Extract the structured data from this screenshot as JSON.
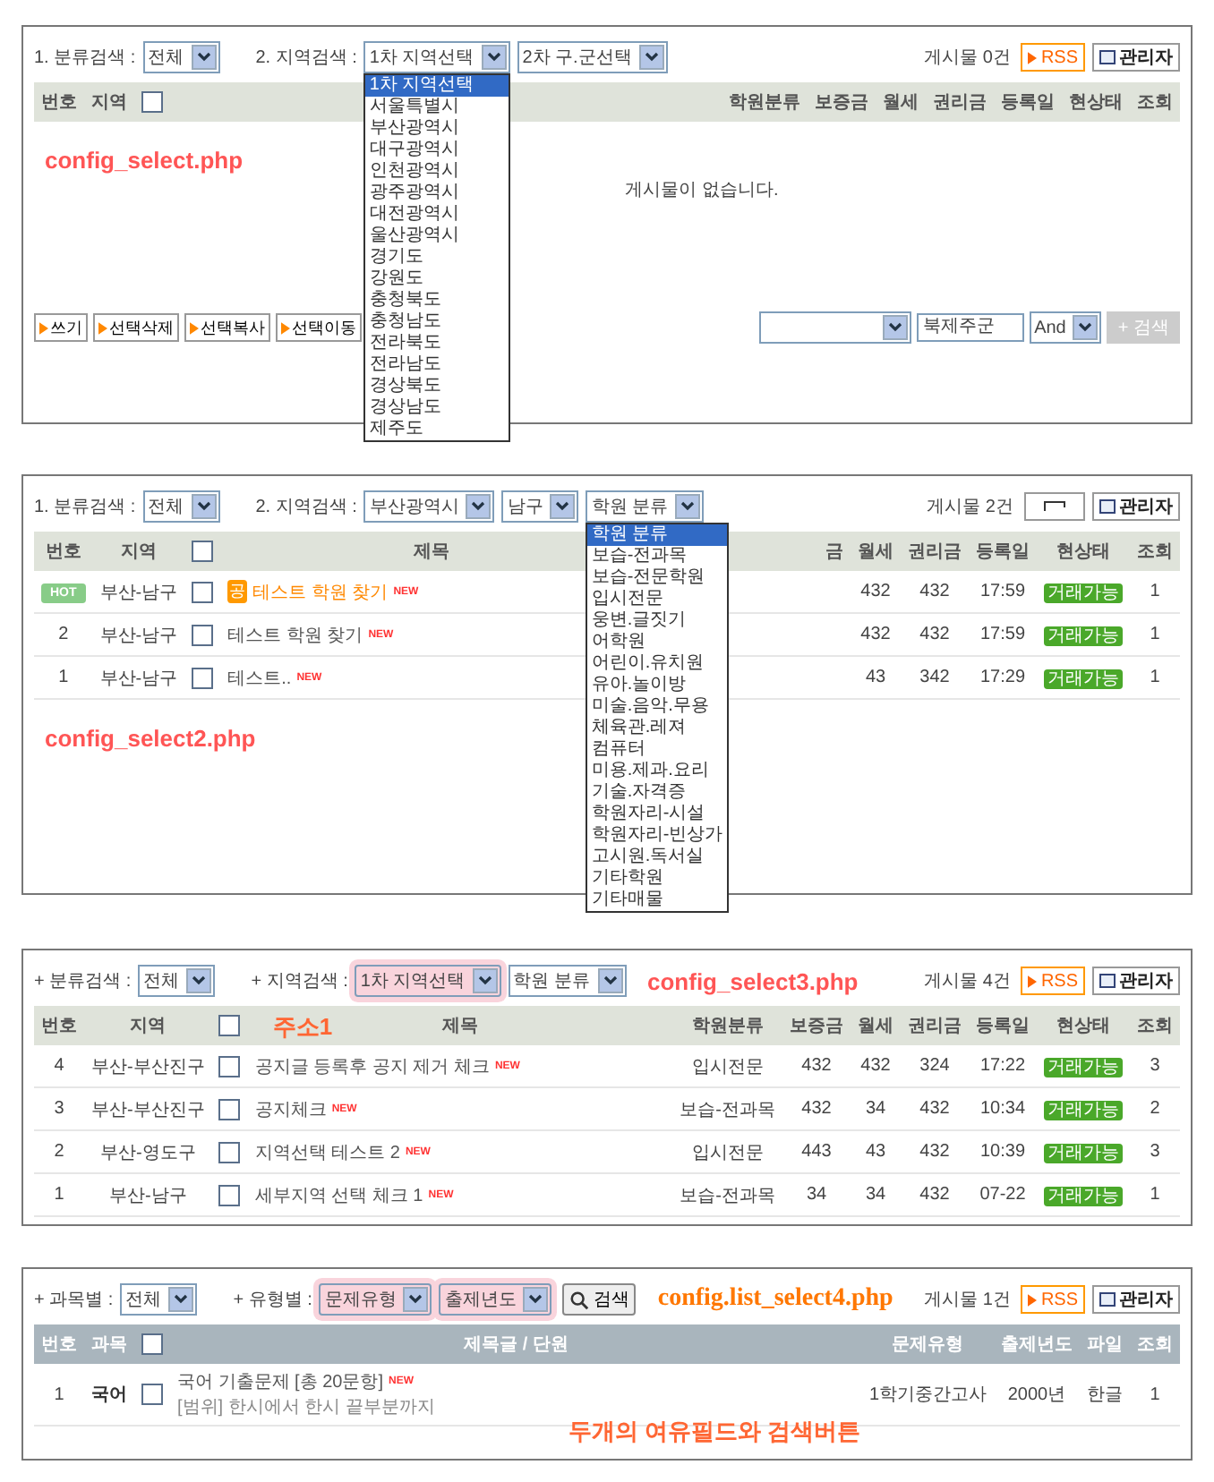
{
  "panels": [
    {
      "kind": "board",
      "filters": [
        {
          "label": "1. 분류검색 :",
          "selects": [
            {
              "value": "전체",
              "highlighted": false
            }
          ]
        },
        {
          "label": "2. 지역검색 :",
          "selects": [
            {
              "value": "1차 지역선택",
              "highlighted": false,
              "options": [
                {
                  "text": "1차 지역선택",
                  "selected": true
                },
                {
                  "text": "서울특별시",
                  "selected": false
                },
                {
                  "text": "부산광역시",
                  "selected": false
                },
                {
                  "text": "대구광역시",
                  "selected": false
                },
                {
                  "text": "인천광역시",
                  "selected": false
                },
                {
                  "text": "광주광역시",
                  "selected": false
                },
                {
                  "text": "대전광역시",
                  "selected": false
                },
                {
                  "text": "울산광역시",
                  "selected": false
                },
                {
                  "text": "경기도",
                  "selected": false
                },
                {
                  "text": "강원도",
                  "selected": false
                },
                {
                  "text": "충청북도",
                  "selected": false
                },
                {
                  "text": "충청남도",
                  "selected": false
                },
                {
                  "text": "전라북도",
                  "selected": false
                },
                {
                  "text": "전라남도",
                  "selected": false
                },
                {
                  "text": "경상북도",
                  "selected": false
                },
                {
                  "text": "경상남도",
                  "selected": false
                },
                {
                  "text": "제주도",
                  "selected": false
                }
              ]
            },
            {
              "value": "2차 구.군선택",
              "highlighted": false
            }
          ]
        }
      ],
      "count": "게시물 0건",
      "buttons": [
        {
          "kind": "rss",
          "label": "RSS"
        },
        {
          "kind": "admin",
          "label": "관리자"
        }
      ],
      "body_caption": {
        "kind": "filename",
        "text": "config_select.php"
      },
      "columns": [
        {
          "kind": "text",
          "label": "번호"
        },
        {
          "kind": "text",
          "label": "지역"
        },
        {
          "kind": "check",
          "checked": false
        },
        {
          "kind": "title"
        },
        {
          "kind": "text",
          "label": "학원분류"
        },
        {
          "kind": "text",
          "label": "보증금"
        },
        {
          "kind": "text",
          "label": "월세"
        },
        {
          "kind": "text",
          "label": "권리금"
        },
        {
          "kind": "text",
          "label": "등록일"
        },
        {
          "kind": "text",
          "label": "현상태"
        },
        {
          "kind": "text",
          "label": "조회"
        }
      ],
      "empty_text": "게시물이 없습니다.",
      "actions": [
        "쓰기",
        "선택삭제",
        "선택복사",
        "선택이동"
      ],
      "search": {
        "keyword": "북제주군",
        "operator": "And",
        "button": "+ 검색",
        "disabled": true
      }
    },
    {
      "kind": "board",
      "filters": [
        {
          "label": "1. 분류검색 :",
          "selects": [
            {
              "value": "전체",
              "highlighted": false
            }
          ]
        },
        {
          "label": "2. 지역검색 :",
          "selects": [
            {
              "value": "부산광역시",
              "highlighted": false
            },
            {
              "value": "남구",
              "highlighted": false
            },
            {
              "value": "학원 분류",
              "highlighted": false,
              "options": [
                {
                  "text": "학원 분류",
                  "selected": true
                },
                {
                  "text": "보습-전과목",
                  "selected": false
                },
                {
                  "text": "보습-전문학원",
                  "selected": false
                },
                {
                  "text": "입시전문",
                  "selected": false
                },
                {
                  "text": "웅변.글짓기",
                  "selected": false
                },
                {
                  "text": "어학원",
                  "selected": false
                },
                {
                  "text": "어린이.유치원",
                  "selected": false
                },
                {
                  "text": "유아.놀이방",
                  "selected": false
                },
                {
                  "text": "미술.음악.무용",
                  "selected": false
                },
                {
                  "text": "체육관.레져",
                  "selected": false
                },
                {
                  "text": "컴퓨터",
                  "selected": false
                },
                {
                  "text": "미용.제과.요리",
                  "selected": false
                },
                {
                  "text": "기술.자격증",
                  "selected": false
                },
                {
                  "text": "학원자리-시설",
                  "selected": false
                },
                {
                  "text": "학원자리-빈상가",
                  "selected": false
                },
                {
                  "text": "고시원.독서실",
                  "selected": false
                },
                {
                  "text": "기타학원",
                  "selected": false
                },
                {
                  "text": "기타매물",
                  "selected": false
                }
              ]
            }
          ]
        }
      ],
      "count": "게시물 2건",
      "buttons": [
        {
          "kind": "blank"
        },
        {
          "kind": "admin",
          "label": "관리자"
        }
      ],
      "body_caption": {
        "kind": "filename",
        "text": "config_select2.php"
      },
      "columns": [
        {
          "kind": "text",
          "label": "번호"
        },
        {
          "kind": "text",
          "label": "지역"
        },
        {
          "kind": "check",
          "checked": false
        },
        {
          "kind": "title",
          "label": "제목"
        },
        {
          "kind": "covered"
        },
        {
          "kind": "text",
          "label": "금"
        },
        {
          "kind": "text",
          "label": "월세"
        },
        {
          "kind": "text",
          "label": "권리금"
        },
        {
          "kind": "text",
          "label": "등록일"
        },
        {
          "kind": "text",
          "label": "현상태"
        },
        {
          "kind": "text",
          "label": "조회"
        }
      ],
      "rows": [
        {
          "cells": [
            {
              "kind": "hot",
              "text": "HOT"
            },
            {
              "kind": "text",
              "text": "부산-남구"
            },
            {
              "kind": "check",
              "checked": false
            },
            {
              "kind": "title",
              "notice": "공",
              "text": "테스트 학원 찾기",
              "new": "NEW"
            },
            {
              "kind": "covered"
            },
            {
              "kind": "covered"
            },
            {
              "kind": "text",
              "text": "432"
            },
            {
              "kind": "text",
              "text": "432"
            },
            {
              "kind": "text",
              "text": "17:59"
            },
            {
              "kind": "status",
              "text": "거래가능"
            },
            {
              "kind": "text",
              "text": "1"
            }
          ]
        },
        {
          "cells": [
            {
              "kind": "text",
              "text": "2"
            },
            {
              "kind": "text",
              "text": "부산-남구"
            },
            {
              "kind": "check",
              "checked": false
            },
            {
              "kind": "title",
              "text": "테스트 학원 찾기",
              "new": "NEW"
            },
            {
              "kind": "covered"
            },
            {
              "kind": "covered"
            },
            {
              "kind": "text",
              "text": "432"
            },
            {
              "kind": "text",
              "text": "432"
            },
            {
              "kind": "text",
              "text": "17:59"
            },
            {
              "kind": "status",
              "text": "거래가능"
            },
            {
              "kind": "text",
              "text": "1"
            }
          ]
        },
        {
          "cells": [
            {
              "kind": "text",
              "text": "1"
            },
            {
              "kind": "text",
              "text": "부산-남구"
            },
            {
              "kind": "check",
              "checked": false
            },
            {
              "kind": "title",
              "text": "테스트..",
              "new": "NEW"
            },
            {
              "kind": "covered"
            },
            {
              "kind": "covered"
            },
            {
              "kind": "text",
              "text": "43"
            },
            {
              "kind": "text",
              "text": "342"
            },
            {
              "kind": "text",
              "text": "17:29"
            },
            {
              "kind": "status",
              "text": "거래가능"
            },
            {
              "kind": "text",
              "text": "1"
            }
          ]
        }
      ]
    },
    {
      "kind": "board",
      "filters": [
        {
          "label": "+ 분류검색 :",
          "selects": [
            {
              "value": "전체",
              "highlighted": false
            }
          ]
        },
        {
          "label": "+ 지역검색 :",
          "selects": [
            {
              "value": "1차 지역선택",
              "highlighted": true
            },
            {
              "value": "학원 분류",
              "highlighted": false
            }
          ]
        }
      ],
      "count": "게시물 4건",
      "buttons": [
        {
          "kind": "rss",
          "label": "RSS"
        },
        {
          "kind": "admin",
          "label": "관리자"
        }
      ],
      "toolbar_caption": {
        "kind": "filename",
        "text": "config_select3.php"
      },
      "header_note": {
        "kind": "note",
        "text": "주소1"
      },
      "columns": [
        {
          "kind": "text",
          "label": "번호"
        },
        {
          "kind": "text",
          "label": "지역"
        },
        {
          "kind": "check",
          "checked": false
        },
        {
          "kind": "title",
          "label": "제목"
        },
        {
          "kind": "text",
          "label": "학원분류"
        },
        {
          "kind": "text",
          "label": "보증금"
        },
        {
          "kind": "text",
          "label": "월세"
        },
        {
          "kind": "text",
          "label": "권리금"
        },
        {
          "kind": "text",
          "label": "등록일"
        },
        {
          "kind": "text",
          "label": "현상태"
        },
        {
          "kind": "text",
          "label": "조회"
        }
      ],
      "rows": [
        {
          "cells": [
            {
              "kind": "text",
              "text": "4"
            },
            {
              "kind": "text",
              "text": "부산-부산진구"
            },
            {
              "kind": "check",
              "checked": false
            },
            {
              "kind": "title",
              "text": "공지글 등록후 공지 제거 체크",
              "new": "NEW"
            },
            {
              "kind": "text",
              "text": "입시전문"
            },
            {
              "kind": "text",
              "text": "432"
            },
            {
              "kind": "text",
              "text": "432"
            },
            {
              "kind": "text",
              "text": "324"
            },
            {
              "kind": "text",
              "text": "17:22"
            },
            {
              "kind": "status",
              "text": "거래가능"
            },
            {
              "kind": "text",
              "text": "3"
            }
          ]
        },
        {
          "cells": [
            {
              "kind": "text",
              "text": "3"
            },
            {
              "kind": "text",
              "text": "부산-부산진구"
            },
            {
              "kind": "check",
              "checked": false
            },
            {
              "kind": "title",
              "text": "공지체크",
              "new": "NEW"
            },
            {
              "kind": "text",
              "text": "보습-전과목"
            },
            {
              "kind": "text",
              "text": "432"
            },
            {
              "kind": "text",
              "text": "34"
            },
            {
              "kind": "text",
              "text": "432"
            },
            {
              "kind": "text",
              "text": "10:34"
            },
            {
              "kind": "status",
              "text": "거래가능"
            },
            {
              "kind": "text",
              "text": "2"
            }
          ]
        },
        {
          "cells": [
            {
              "kind": "text",
              "text": "2"
            },
            {
              "kind": "text",
              "text": "부산-영도구"
            },
            {
              "kind": "check",
              "checked": false
            },
            {
              "kind": "title",
              "text": "지역선택 테스트 2",
              "new": "NEW"
            },
            {
              "kind": "text",
              "text": "입시전문"
            },
            {
              "kind": "text",
              "text": "443"
            },
            {
              "kind": "text",
              "text": "43"
            },
            {
              "kind": "text",
              "text": "432"
            },
            {
              "kind": "text",
              "text": "10:39"
            },
            {
              "kind": "status",
              "text": "거래가능"
            },
            {
              "kind": "text",
              "text": "3"
            }
          ]
        },
        {
          "cells": [
            {
              "kind": "text",
              "text": "1"
            },
            {
              "kind": "text",
              "text": "부산-남구"
            },
            {
              "kind": "check",
              "checked": false
            },
            {
              "kind": "title",
              "text": "세부지역 선택 체크 1",
              "new": "NEW"
            },
            {
              "kind": "text",
              "text": "보습-전과목"
            },
            {
              "kind": "text",
              "text": "34"
            },
            {
              "kind": "text",
              "text": "34"
            },
            {
              "kind": "text",
              "text": "432"
            },
            {
              "kind": "text",
              "text": "07-22"
            },
            {
              "kind": "status",
              "text": "거래가능"
            },
            {
              "kind": "text",
              "text": "1"
            }
          ]
        }
      ]
    },
    {
      "kind": "exam",
      "filters": [
        {
          "label": "+ 과목별 :",
          "selects": [
            {
              "value": "전체",
              "highlighted": false
            }
          ]
        },
        {
          "label": "+ 유형별 :",
          "selects": [
            {
              "value": "문제유형",
              "highlighted": true
            },
            {
              "value": "출제년도",
              "highlighted": true
            }
          ]
        }
      ],
      "search_button": "검색",
      "count": "게시물 1건",
      "buttons": [
        {
          "kind": "rss",
          "label": "RSS"
        },
        {
          "kind": "admin",
          "label": "관리자"
        }
      ],
      "toolbar_caption": {
        "kind": "filename-serif",
        "text": "config.list_select4.php"
      },
      "footer_note": {
        "kind": "note",
        "text": "두개의 여유필드와 검색버튼"
      },
      "columns": [
        {
          "kind": "text",
          "label": "번호"
        },
        {
          "kind": "text",
          "label": "과목"
        },
        {
          "kind": "check",
          "checked": false
        },
        {
          "kind": "title",
          "label": "제목글 / 단원"
        },
        {
          "kind": "text",
          "label": "문제유형"
        },
        {
          "kind": "text",
          "label": "출제년도"
        },
        {
          "kind": "text",
          "label": "파일"
        },
        {
          "kind": "text",
          "label": "조회"
        }
      ],
      "rows": [
        {
          "cells": [
            {
              "kind": "text",
              "text": "1"
            },
            {
              "kind": "bold",
              "text": "국어"
            },
            {
              "kind": "check",
              "checked": false
            },
            {
              "kind": "title",
              "text": "국어 기출문제 [총 20문항]",
              "new": "NEW",
              "sub": "[범위] 한시에서 한시 끝부분까지"
            },
            {
              "kind": "text",
              "text": "1학기중간고사"
            },
            {
              "kind": "text",
              "text": "2000년"
            },
            {
              "kind": "text",
              "text": "한글"
            },
            {
              "kind": "text",
              "text": "1"
            }
          ]
        }
      ]
    }
  ]
}
